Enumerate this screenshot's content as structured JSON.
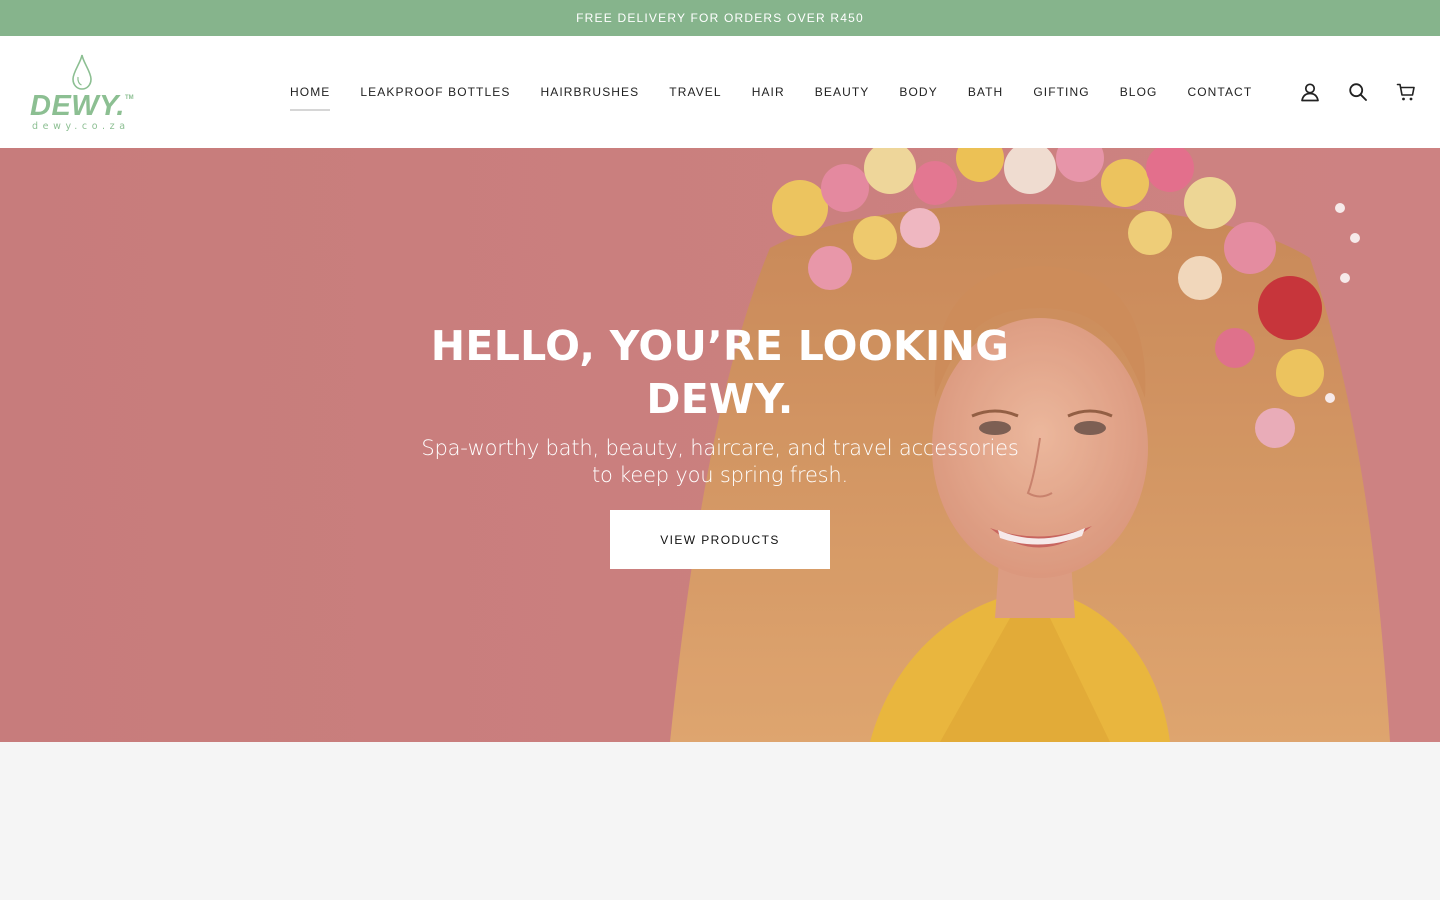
{
  "announcement": {
    "text": "FREE DELIVERY FOR ORDERS OVER R450"
  },
  "colors": {
    "announcement_bg": "#86b48c",
    "brand_green": "#8cbf92",
    "hero_pink": "#c87d7c",
    "text_dark": "#222222"
  },
  "logo": {
    "word": "DEWY.",
    "tm": "TM",
    "sub": "dewy.co.za"
  },
  "nav": {
    "items": [
      {
        "label": "Home",
        "active": true
      },
      {
        "label": "Leakproof Bottles"
      },
      {
        "label": "Hairbrushes"
      },
      {
        "label": "Travel"
      },
      {
        "label": "Hair"
      },
      {
        "label": "Beauty"
      },
      {
        "label": "Body"
      },
      {
        "label": "Bath"
      },
      {
        "label": "Gifting"
      },
      {
        "label": "Blog"
      },
      {
        "label": "Contact"
      }
    ]
  },
  "header_icons": [
    "user-icon",
    "search-icon",
    "cart-icon"
  ],
  "hero": {
    "title": "HELLO, YOU’RE LOOKING DEWY.",
    "subtitle": "Spa-worthy bath, beauty, haircare, and travel accessories to keep you spring fresh.",
    "button_label": "VIEW PRODUCTS"
  }
}
